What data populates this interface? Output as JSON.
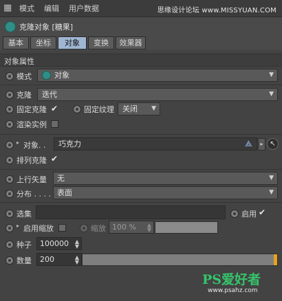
{
  "menubar": {
    "items": [
      "模式",
      "编辑",
      "用户数据"
    ],
    "watermark": "思缘设计论坛 www.MISSYUAN.COM"
  },
  "header": {
    "title": "克隆对象 [糖果]"
  },
  "tabs": [
    "基本",
    "坐标",
    "对象",
    "变换",
    "效果器"
  ],
  "active_tab": "对象",
  "section": {
    "title": "对象属性"
  },
  "fields": {
    "mode": {
      "label": "模式",
      "value": "对象"
    },
    "clone": {
      "label": "克隆",
      "value": "迭代"
    },
    "fix_clone": {
      "label": "固定克隆",
      "checked": true
    },
    "fix_texture": {
      "label": "固定纹理",
      "value": "关闭"
    },
    "render_instance": {
      "label": "渲染实例",
      "checked": false
    },
    "object": {
      "label": "对象. .",
      "value": "巧克力"
    },
    "arrange_clone": {
      "label": "排列克隆",
      "checked": true
    },
    "up_vector": {
      "label": "上行矢量",
      "value": "无"
    },
    "distribution": {
      "label": "分布 . . . .",
      "value": "表面"
    },
    "selection": {
      "label": "选集",
      "value": ""
    },
    "enable": {
      "label": "启用",
      "checked": true
    },
    "enable_scale": {
      "label": "启用缩放",
      "checked": false
    },
    "scale": {
      "label": "缩放",
      "value": "100 %"
    },
    "seed": {
      "label": "种子",
      "value": "100000"
    },
    "count": {
      "label": "数量",
      "value": "200",
      "slider_fraction": 0.995
    }
  },
  "logo": {
    "text": "PS爱好者",
    "url": "www.psahz.com"
  },
  "colors": {
    "accent_tab": "#9fb6d3",
    "slider_fill": "#e9a21b",
    "logo_green": "#35c46b"
  }
}
